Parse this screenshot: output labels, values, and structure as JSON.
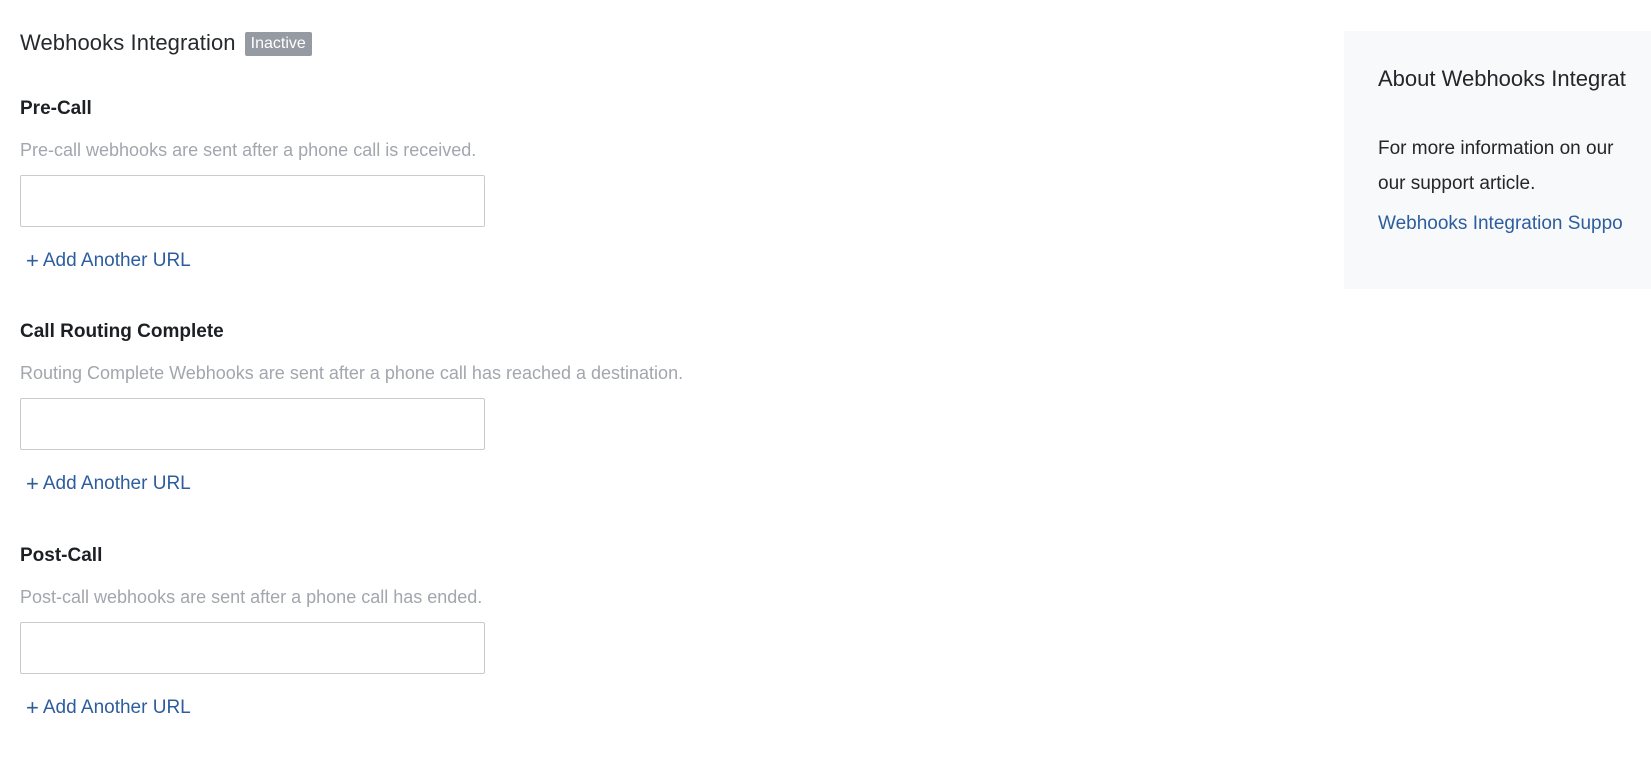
{
  "header": {
    "title": "Webhooks Integration",
    "status": "Inactive"
  },
  "sections": [
    {
      "title": "Pre-Call",
      "description": "Pre-call webhooks are sent after a phone call is received.",
      "input_value": "",
      "add_label": "Add Another URL"
    },
    {
      "title": "Call Routing Complete",
      "description": "Routing Complete Webhooks are sent after a phone call has reached a destination.",
      "input_value": "",
      "add_label": "Add Another URL"
    },
    {
      "title": "Post-Call",
      "description": "Post-call webhooks are sent after a phone call has ended.",
      "input_value": "",
      "add_label": "Add Another URL"
    }
  ],
  "sidebar": {
    "title": "About Webhooks Integrat",
    "text_line1": "For more information on our",
    "text_line2": "our support article.",
    "link": "Webhooks Integration Suppo"
  },
  "colors": {
    "link": "#2d5d9f",
    "badge": "#969aa3",
    "muted_text": "#a2a6ad",
    "sidebar_bg": "#f8f9fa"
  },
  "icons": {
    "add": "plus-icon"
  }
}
